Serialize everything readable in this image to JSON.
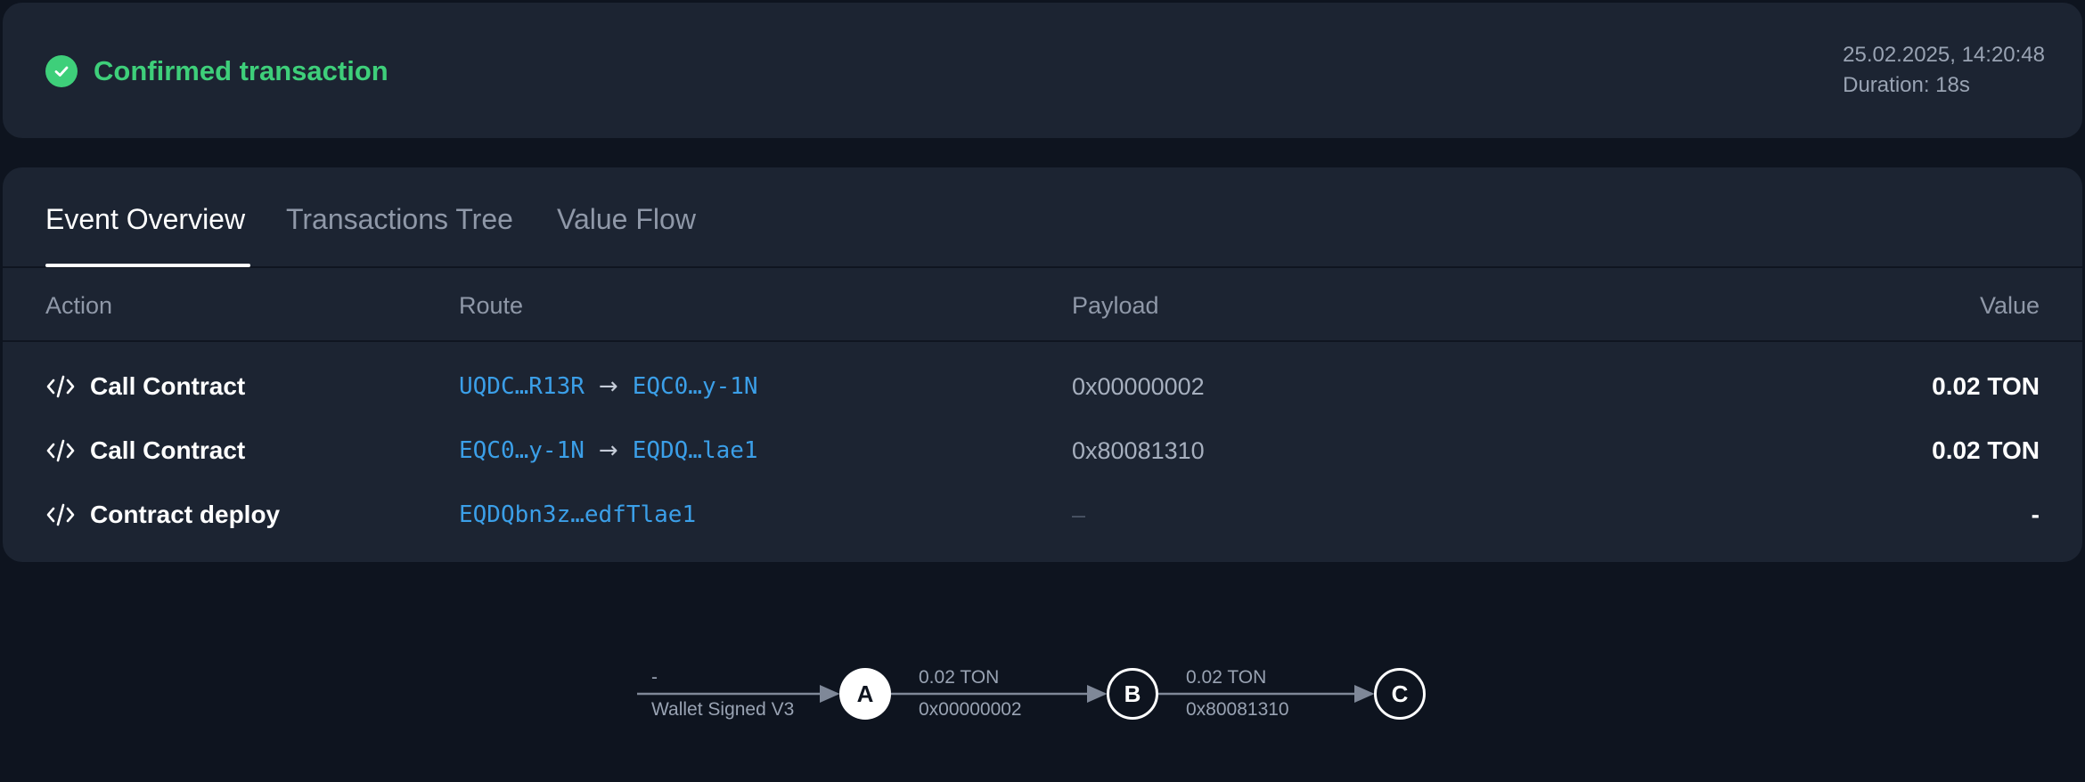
{
  "status": {
    "title": "Confirmed transaction",
    "datetime": "25.02.2025, 14:20:48",
    "duration": "Duration: 18s",
    "color": "#3ecf7a"
  },
  "tabs": [
    {
      "label": "Event Overview",
      "active": true
    },
    {
      "label": "Transactions Tree",
      "active": false
    },
    {
      "label": "Value Flow",
      "active": false
    }
  ],
  "table": {
    "headers": {
      "action": "Action",
      "route": "Route",
      "payload": "Payload",
      "value": "Value"
    },
    "rows": [
      {
        "action": "Call Contract",
        "from": "UQDC…R13R",
        "to": "EQC0…y-1N",
        "payload": "0x00000002",
        "value": "0.02 TON"
      },
      {
        "action": "Call Contract",
        "from": "EQC0…y-1N",
        "to": "EQDQ…lae1",
        "payload": "0x80081310",
        "value": "0.02 TON"
      },
      {
        "action": "Contract deploy",
        "from": "EQDQbn3z…edfTlae1",
        "to": "",
        "payload": "–",
        "value": "-"
      }
    ]
  },
  "flow": {
    "edges": [
      {
        "top": "-",
        "bottom": "Wallet Signed V3"
      },
      {
        "top": "0.02 TON",
        "bottom": "0x00000002"
      },
      {
        "top": "0.02 TON",
        "bottom": "0x80081310"
      }
    ],
    "nodes": [
      "A",
      "B",
      "C"
    ]
  },
  "icons": {
    "status": "check-circle-icon",
    "action": "code-icon",
    "route_arrow": "arrow-right-icon"
  },
  "colors": {
    "link": "#3b9fe8",
    "background": "#0e141f",
    "card": "#1c2432"
  }
}
